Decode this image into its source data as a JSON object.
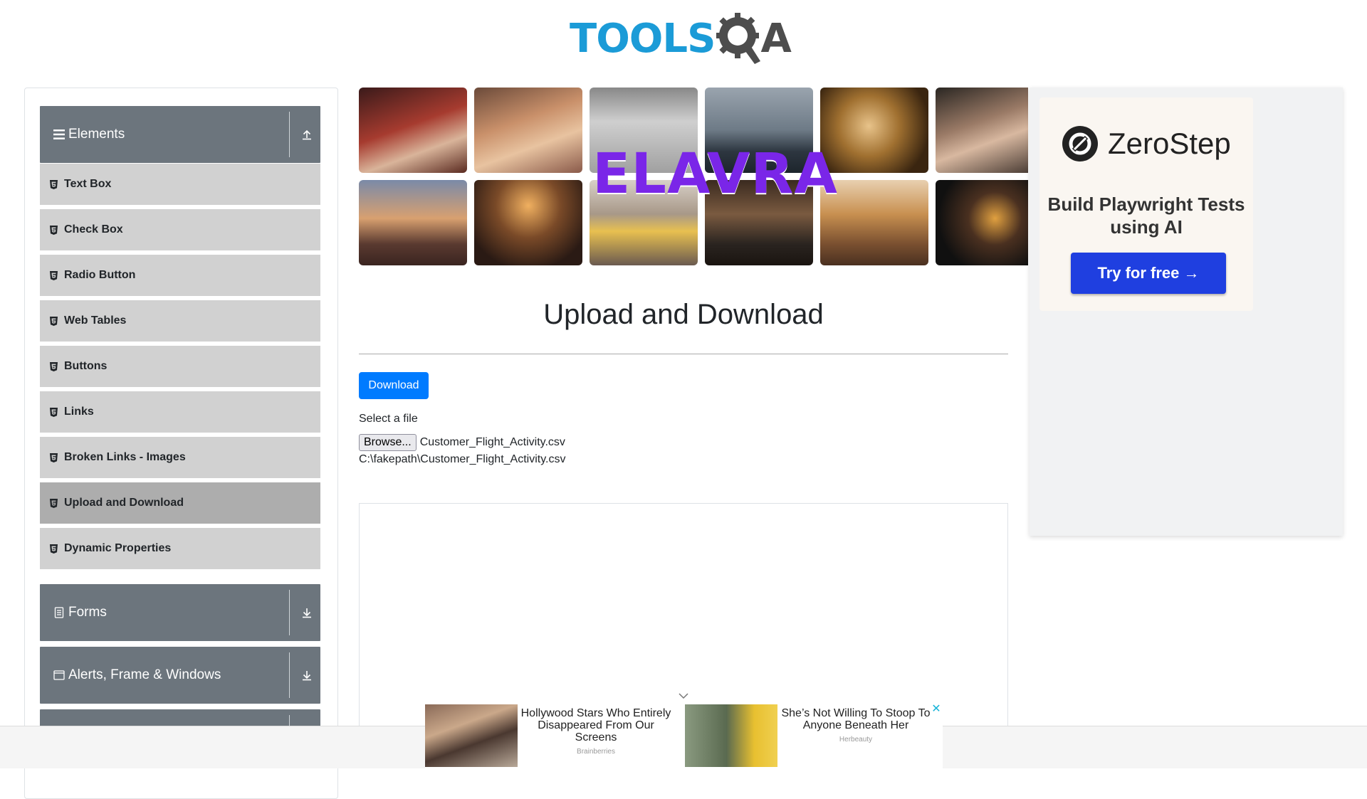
{
  "header": {
    "logo_text_left": "TOOLS",
    "logo_text_right": "A",
    "colors": {
      "tools": "#1b9bd7",
      "qa": "#4d4d4d"
    }
  },
  "sidebar": {
    "groups": [
      {
        "label": "Elements",
        "icon": "hamburger-icon",
        "expanded": true,
        "toggle_icon": "upload-arrow-icon"
      },
      {
        "label": "Forms",
        "icon": "document-icon",
        "expanded": false,
        "toggle_icon": "download-arrow-icon"
      },
      {
        "label": "Alerts, Frame & Windows",
        "icon": "window-icon",
        "expanded": false,
        "toggle_icon": "download-arrow-icon"
      }
    ],
    "items": [
      {
        "label": "Text Box",
        "icon": "html5-icon"
      },
      {
        "label": "Check Box",
        "icon": "html5-icon"
      },
      {
        "label": "Radio Button",
        "icon": "html5-icon"
      },
      {
        "label": "Web Tables",
        "icon": "html5-icon"
      },
      {
        "label": "Buttons",
        "icon": "html5-icon"
      },
      {
        "label": "Links",
        "icon": "html5-icon"
      },
      {
        "label": "Broken Links - Images",
        "icon": "html5-icon"
      },
      {
        "label": "Upload and Download",
        "icon": "html5-icon",
        "active": true
      },
      {
        "label": "Dynamic Properties",
        "icon": "html5-icon"
      }
    ],
    "colors": {
      "group_bg": "#6c757d",
      "item_bg": "#d1d1d1",
      "item_active_bg": "#adadad"
    }
  },
  "banner": {
    "brand": "ELAVRA",
    "brand_color": "#7a26e8"
  },
  "ad_right": {
    "brand": "ZeroStep",
    "subtitle": "Build Playwright Tests using AI",
    "cta": "Try for free →",
    "cta_color": "#1f3fe0"
  },
  "main": {
    "title": "Upload and Download",
    "download_label": "Download",
    "download_color": "#007bff",
    "select_label": "Select a file",
    "browse_label": "Browse...",
    "file_name": "Customer_Flight_Activity.csv",
    "uploaded_path": "C:\\fakepath\\Customer_Flight_Activity.csv"
  },
  "ad_bottom": {
    "units": [
      {
        "headline": "Hollywood Stars Who Entirely Disappeared From Our Screens",
        "source": "Brainberries"
      },
      {
        "headline": "She’s Not Willing To Stoop To Anyone Beneath Her",
        "source": "Herbeauty"
      }
    ],
    "close_symbol": "✕",
    "close_color": "#18b4d8"
  }
}
